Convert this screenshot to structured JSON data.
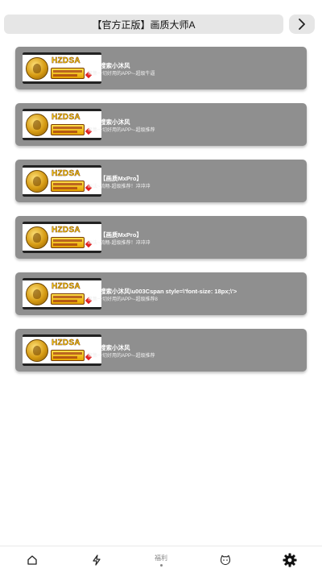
{
  "header": {
    "title": "【官方正版】画质大师A",
    "next_icon": "chevron-right-icon"
  },
  "cards": [
    {
      "brand": "HZDSA",
      "title": "快手搜索小沐风",
      "subtitle": "聚集一切好用的APP~-超级牛逼"
    },
    {
      "brand": "HZDSA",
      "title": "快手搜索小沐风",
      "subtitle": "聚集一切好用的APP~-超级推荐"
    },
    {
      "brand": "HZDSA",
      "title": "领取【画质MxPro】",
      "subtitle": "画法~流畅-超级推荐！冲冲冲"
    },
    {
      "brand": "HZDSA",
      "title": "领取【画质MxPro】",
      "subtitle": "画法~流畅-超级推荐！冲冲冲"
    },
    {
      "brand": "HZDSA",
      "title": "快手搜索小沐风\\u003Cspan style=\\'font-size: 18px;\\'>",
      "subtitle": "聚集一切好用的APP~-超级推荐8"
    },
    {
      "brand": "HZDSA",
      "title": "快手搜索小沐风",
      "subtitle": "聚集一切好用的APP~-超级推荐"
    }
  ],
  "tabbar": {
    "items": [
      {
        "icon": "home-icon",
        "label": ""
      },
      {
        "icon": "lightning-icon",
        "label": ""
      },
      {
        "icon": "dot-icon",
        "label": "福利"
      },
      {
        "icon": "cat-face-icon",
        "label": ""
      },
      {
        "icon": "gear-icon",
        "label": ""
      }
    ]
  },
  "colors": {
    "card_bg": "#8f8f8f",
    "pill_bg": "#e6e6e6",
    "brand_yellow": "#ffd200"
  }
}
